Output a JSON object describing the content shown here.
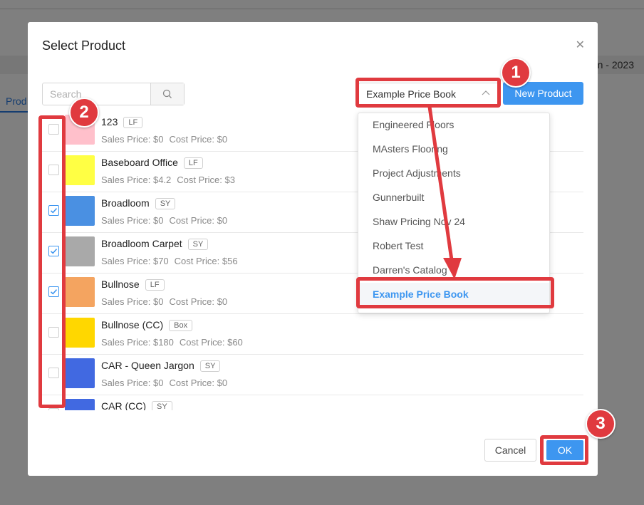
{
  "background": {
    "band_text": "n - 2023",
    "tab_label": "Prod"
  },
  "modal": {
    "title": "Select Product",
    "close_icon": "close-icon",
    "search": {
      "placeholder": "Search",
      "value": ""
    },
    "price_book_select": {
      "value": "Example Price Book"
    },
    "new_product_label": "New Product",
    "products": [
      {
        "name": "123",
        "unit": "LF",
        "sales_label": "Sales Price: $0",
        "cost_label": "Cost Price: $0",
        "color": "#ffc0cb",
        "checked": false
      },
      {
        "name": "Baseboard Office",
        "unit": "LF",
        "sales_label": "Sales Price: $4.2",
        "cost_label": "Cost Price: $3",
        "color": "#ffff44",
        "checked": false
      },
      {
        "name": "Broadloom",
        "unit": "SY",
        "sales_label": "Sales Price: $0",
        "cost_label": "Cost Price: $0",
        "color": "#4a90e2",
        "checked": true
      },
      {
        "name": "Broadloom Carpet",
        "unit": "SY",
        "sales_label": "Sales Price: $70",
        "cost_label": "Cost Price: $56",
        "color": "#a9a9a9",
        "checked": true
      },
      {
        "name": "Bullnose",
        "unit": "LF",
        "sales_label": "Sales Price: $0",
        "cost_label": "Cost Price: $0",
        "color": "#f4a460",
        "checked": true
      },
      {
        "name": "Bullnose (CC)",
        "unit": "Box",
        "sales_label": "Sales Price: $180",
        "cost_label": "Cost Price: $60",
        "color": "#ffd700",
        "checked": false
      },
      {
        "name": "CAR - Queen Jargon",
        "unit": "SY",
        "sales_label": "Sales Price: $0",
        "cost_label": "Cost Price: $0",
        "color": "#4169e1",
        "checked": false
      },
      {
        "name": "CAR (CC)",
        "unit": "SY",
        "sales_label": "",
        "cost_label": "",
        "color": "#4169e1",
        "checked": false
      }
    ],
    "dropdown_options": [
      {
        "label": "Engineered Floors",
        "selected": false
      },
      {
        "label": "MAsters Flooring",
        "selected": false
      },
      {
        "label": "Project Adjustments",
        "selected": false
      },
      {
        "label": "Gunnerbuilt",
        "selected": false
      },
      {
        "label": "Shaw Pricing Nov 24",
        "selected": false
      },
      {
        "label": "Robert Test",
        "selected": false
      },
      {
        "label": "Darren's Catalog",
        "selected": false
      },
      {
        "label": "Example Price Book",
        "selected": true
      }
    ],
    "cancel_label": "Cancel",
    "ok_label": "OK"
  },
  "annotations": {
    "badges": [
      "1",
      "2",
      "3"
    ],
    "color": "#e03a3f"
  },
  "colors": {
    "accent": "#3d96f0",
    "annotation": "#e03a3f"
  }
}
